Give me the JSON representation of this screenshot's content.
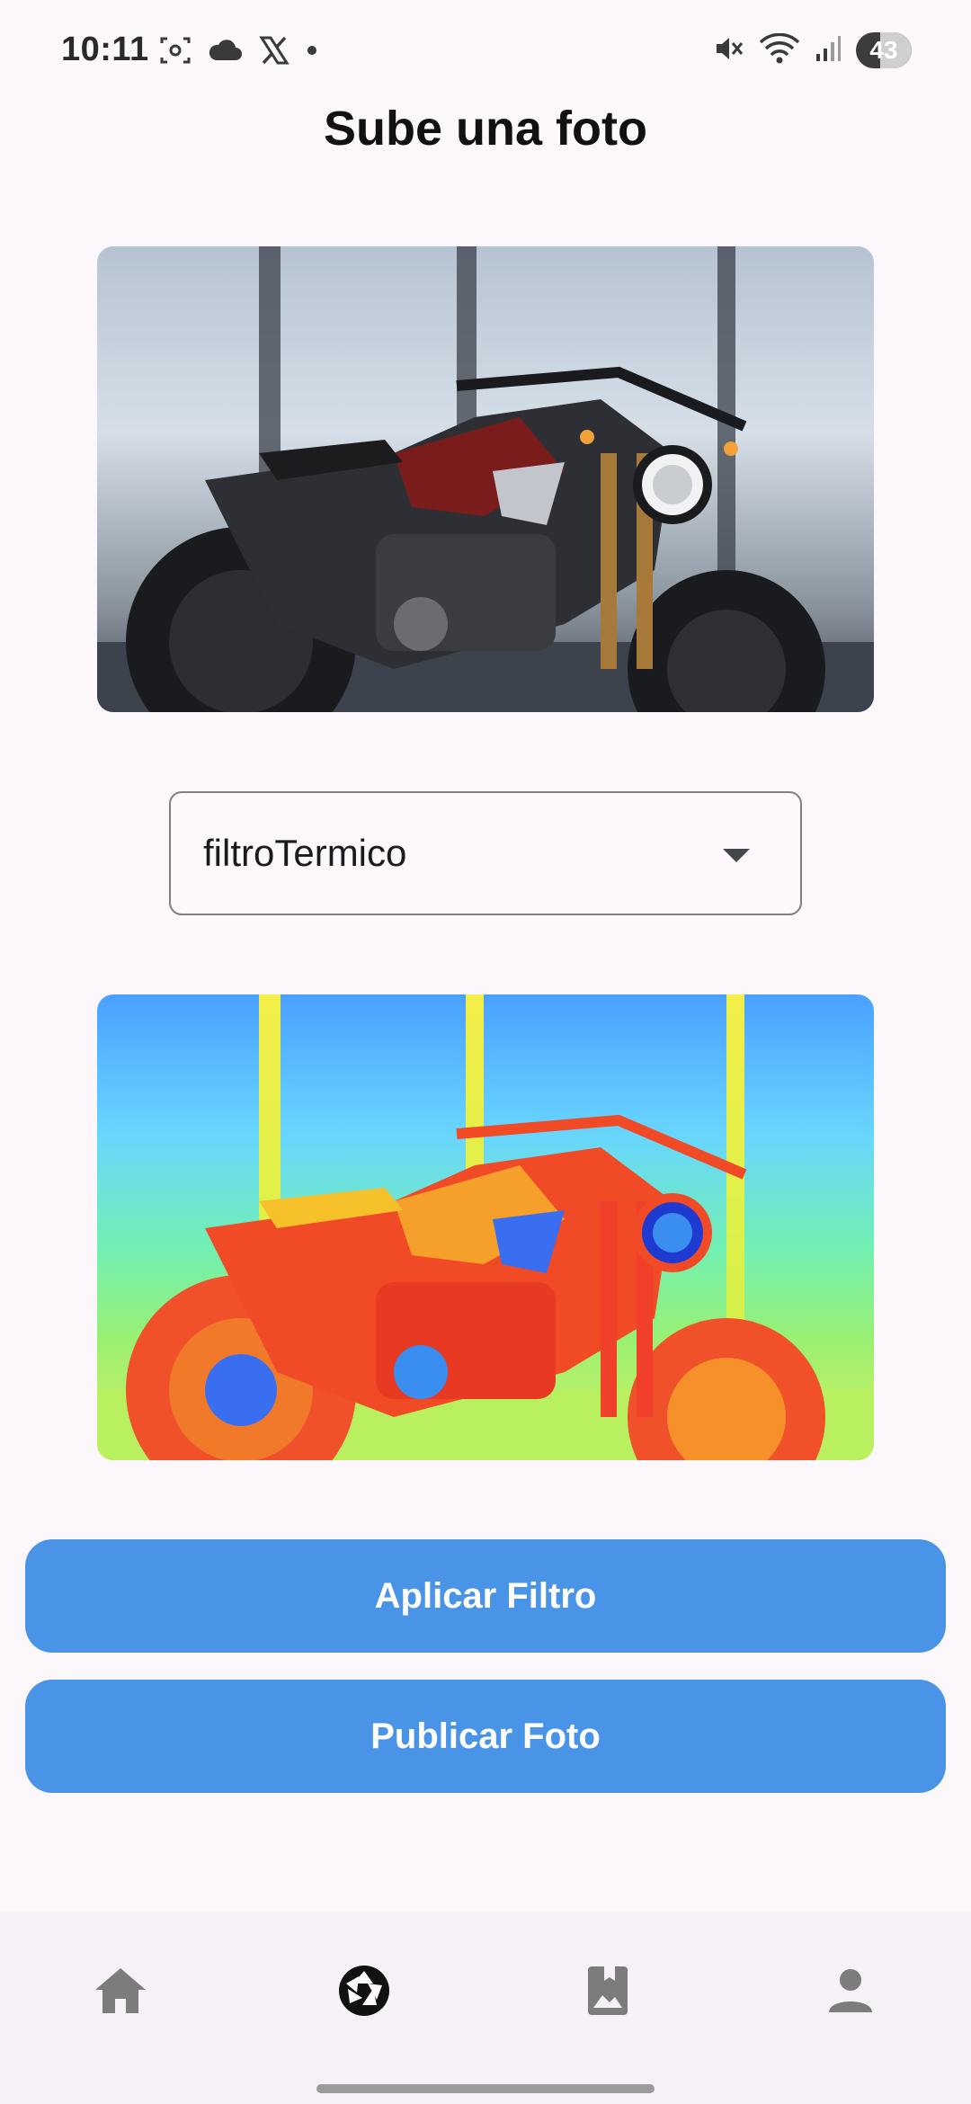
{
  "status_bar": {
    "time": "10:11",
    "left_icons": [
      "screenshot-icon",
      "cloud-icon",
      "x-logo-icon",
      "dot-icon"
    ],
    "right_icons": [
      "mute-icon",
      "wifi-icon",
      "signal-icon"
    ],
    "battery_level": "43",
    "battery_fraction": 0.43
  },
  "page": {
    "title": "Sube una foto"
  },
  "original_photo": {
    "icon": "motorcycle-photo",
    "description_colors": [
      "#b6c3d2",
      "#3c3c3c",
      "#8a1c1c"
    ]
  },
  "filter_select": {
    "selected": "filtroTermico",
    "icon": "arrow-drop-down-icon"
  },
  "filtered_photo": {
    "icon": "thermal-motorcycle-photo"
  },
  "buttons": {
    "apply_label": "Aplicar Filtro",
    "publish_label": "Publicar Foto"
  },
  "bottom_nav": {
    "items": [
      {
        "icon": "home-icon",
        "active": false
      },
      {
        "icon": "camera-shutter-icon",
        "active": true
      },
      {
        "icon": "gallery-bookmark-icon",
        "active": false
      },
      {
        "icon": "person-icon",
        "active": false
      }
    ]
  },
  "colors": {
    "background": "#fbf7fb",
    "button": "#4a94e8",
    "button_text": "#ffffff",
    "nav_inactive": "#7c7c7c",
    "nav_active": "#111111"
  }
}
